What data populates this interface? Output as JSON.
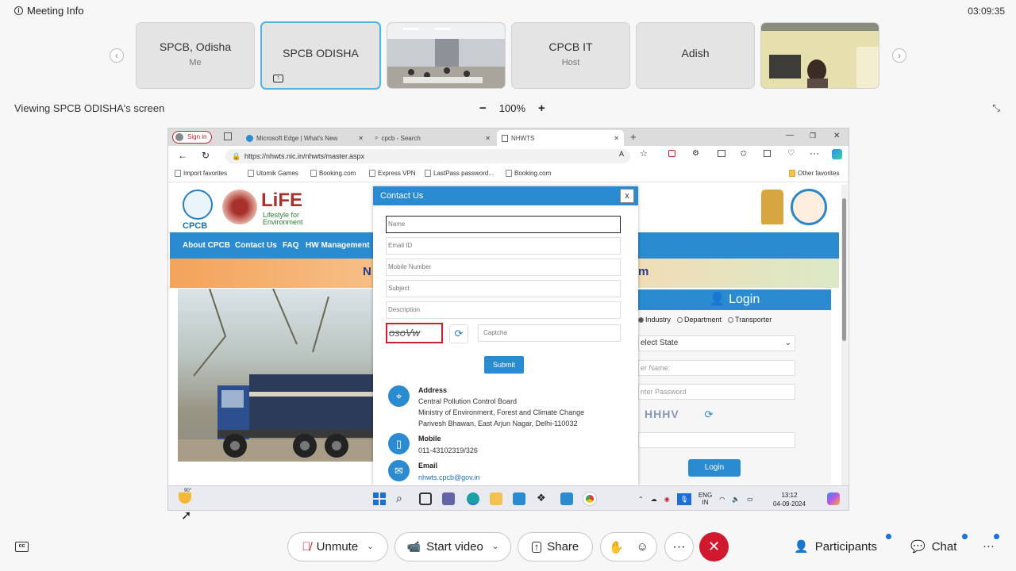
{
  "top": {
    "meeting_info": "Meeting Info",
    "timer": "03:09:35"
  },
  "tiles": [
    {
      "name": "SPCB, Odisha",
      "sub": "Me"
    },
    {
      "name": "SPCB ODISHA",
      "sub": ""
    },
    {
      "name": "",
      "sub": ""
    },
    {
      "name": "CPCB IT",
      "sub": "Host"
    },
    {
      "name": "Adish",
      "sub": ""
    },
    {
      "name": "",
      "sub": ""
    }
  ],
  "viewing": "Viewing SPCB ODISHA's screen",
  "zoom": {
    "minus": "−",
    "level": "100%",
    "plus": "+"
  },
  "browser": {
    "signin": "Sign in",
    "tabs": [
      "Microsoft Edge | What's New",
      "cpcb - Search",
      "NHWTS"
    ],
    "url": "https://nhwts.nic.in/nhwts/master.aspx",
    "favorites": [
      "Import favorites",
      "Utomik Games",
      "Booking.com",
      "Express VPN",
      "LastPass password...",
      "Booking.com"
    ],
    "other_favorites": "Other favorites"
  },
  "site": {
    "cpcb": "CPCB",
    "life": "LiFE",
    "life_sub1": "Lifestyle for",
    "life_sub2": "Environment",
    "nav": [
      "About CPCB",
      "Contact Us",
      "FAQ",
      "HW Management"
    ],
    "banner_left": "N",
    "banner_right": "m",
    "login": {
      "title": "Login",
      "radios": [
        "Industry",
        "Department",
        "Transporter"
      ],
      "state": "elect State",
      "user": "er Name:",
      "password": "nter Password",
      "captcha": "HHHV",
      "button": "Login"
    }
  },
  "modal": {
    "title": "Contact Us",
    "close": "x",
    "fields": [
      "Name",
      "Email ID",
      "Mobile Number",
      "Subject",
      "Description"
    ],
    "captcha_img": "osoVw",
    "captcha_placeholder": "Captcha",
    "submit": "Submit",
    "address_label": "Address",
    "address_lines": [
      "Central Pollution Control Board",
      "Ministry of Environment, Forest and Climate Change",
      "Parivesh Bhawan, East Arjun Nagar, Delhi-110032"
    ],
    "mobile_label": "Mobile",
    "mobile": "011-43102319/326",
    "email_label": "Email",
    "email": "nhwts.cpcb@gov.in"
  },
  "taskbar": {
    "weather": "90°",
    "lang1": "ENG",
    "lang2": "IN",
    "time": "13:12",
    "date": "04-09-2024"
  },
  "controls": {
    "unmute": "Unmute",
    "start_video": "Start video",
    "share": "Share",
    "participants": "Participants",
    "chat": "Chat"
  },
  "colors": {
    "accent": "#2a8bd0",
    "end_call": "#d2182e",
    "active_tile": "#4fb4e0"
  }
}
